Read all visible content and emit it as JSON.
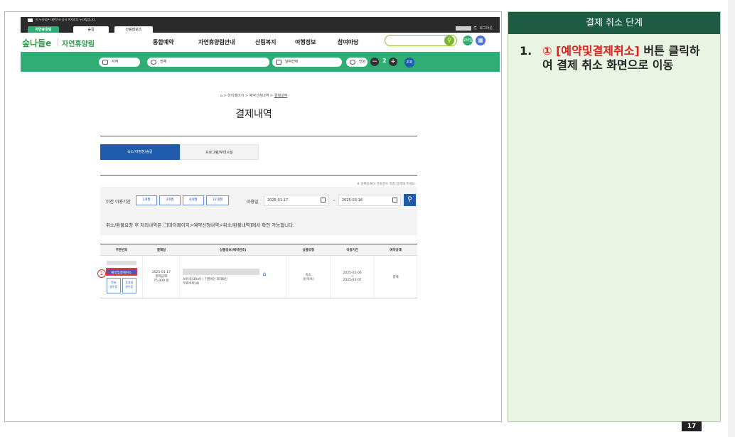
{
  "gov_banner": "이 누리집은 대한민국 공식 전자정부 누리집입니다.",
  "site_tabs": [
    "자연휴양림",
    "숲길",
    "산림레포츠"
  ],
  "top_right": {
    "logout": "로그아웃"
  },
  "logo": {
    "mark": "숲나들e",
    "name": "자연휴양림"
  },
  "nav": [
    "통합예약",
    "자연휴양림안내",
    "산림복지",
    "여행정보",
    "참여마당"
  ],
  "header_icons": {
    "search": "search-icon",
    "mobile": "모바일",
    "menu": "grid-menu-icon"
  },
  "search_bar": {
    "region": "지역",
    "all": "전체",
    "date": "날짜선택",
    "people_label": "인원",
    "people_count": "2",
    "query": "조회"
  },
  "breadcrumb": {
    "home": "⌂",
    "sep": ">",
    "mypage": "마이페이지",
    "apply": "예약신청내역",
    "current": "결제내역"
  },
  "page_title": "결제내역",
  "tabs": [
    "숙소/야영장/숲길",
    "프로그램/부대시설"
  ],
  "notice": "※ 날짜등록이 안될경우 직접 입력해 주세요.",
  "filter": {
    "period_label": "이전 이용기간",
    "periods": [
      "1개월",
      "3개월",
      "6개월",
      "12개월"
    ],
    "use_date_label": "이용일",
    "from": "2025-01-17",
    "tilde": "~",
    "to": "2025-03-16",
    "info": "취소/환불요청 후 처리내역은 🗋[마이페이지>예약신청내역>취소/환불내역]에서 확인 가능합니다."
  },
  "table": {
    "headers": [
      "주문번호",
      "결제일",
      "상품정보(예약번호)",
      "상품유형",
      "이용기간",
      "예약상태"
    ],
    "row": {
      "cancel_button": "예약및결제취소",
      "receipt1_l1": "전표",
      "receipt1_l2": "영수증",
      "receipt2_l1": "휴양림",
      "receipt2_l2": "영수증",
      "pay_date": "2025-01-17",
      "pay_amount_label": "결제금액",
      "pay_amount": "75,000 원",
      "product_l1": "보유각(39㎡) | 기준6인 최대6인",
      "product_l2": "무료숙박(4)",
      "type_l1": "숙소",
      "type_l2": "(산막숙)",
      "period_from": "2025-02-06",
      "period_tilde": "~",
      "period_to": "2025-02-07",
      "status": "결제"
    }
  },
  "annotation_number": "1",
  "panel": {
    "title": "결제 취소 단계",
    "step_num": "1.",
    "step_highlight": "① [예약및결제취소]",
    "step_rest": " 버튼 클릭하여 결제 취소 화면으로 이동"
  },
  "page_number": "17",
  "colors": {
    "green": "#2eae74",
    "blue": "#1e5bab",
    "red": "#e02020",
    "panel_head": "#1e5b45"
  }
}
